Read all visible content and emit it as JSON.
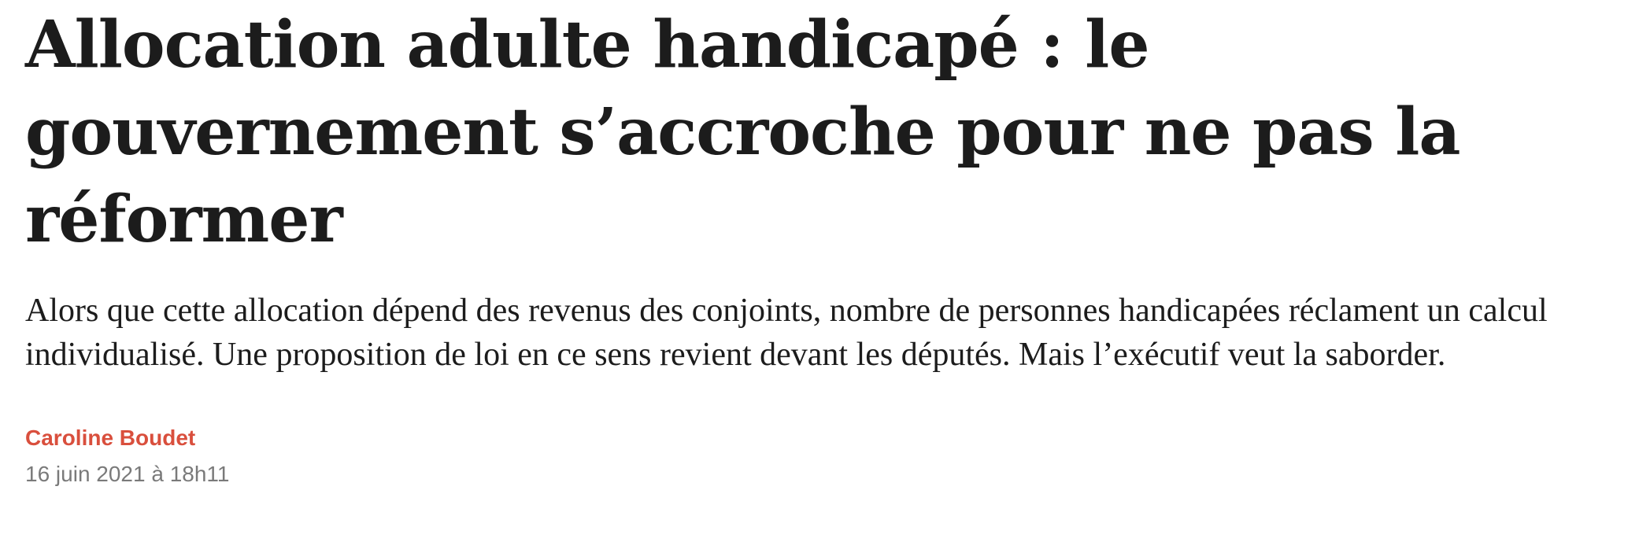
{
  "article": {
    "title": "Allocation adulte handicapé : le gouvernement s’accroche pour ne pas la réformer",
    "lede": "Alors que cette allocation dépend des revenus des conjoints, nombre de personnes handicapées réclament un calcul individualisé. Une proposition de loi en ce sens revient devant les députés. Mais l’exécutif veut la saborder.",
    "author": "Caroline Boudet",
    "date": "16 juin 2021 à 18h11"
  },
  "colors": {
    "text": "#1c1c1c",
    "author_accent": "#d94f3d",
    "date_gray": "#7a7a7a",
    "background": "#ffffff"
  }
}
